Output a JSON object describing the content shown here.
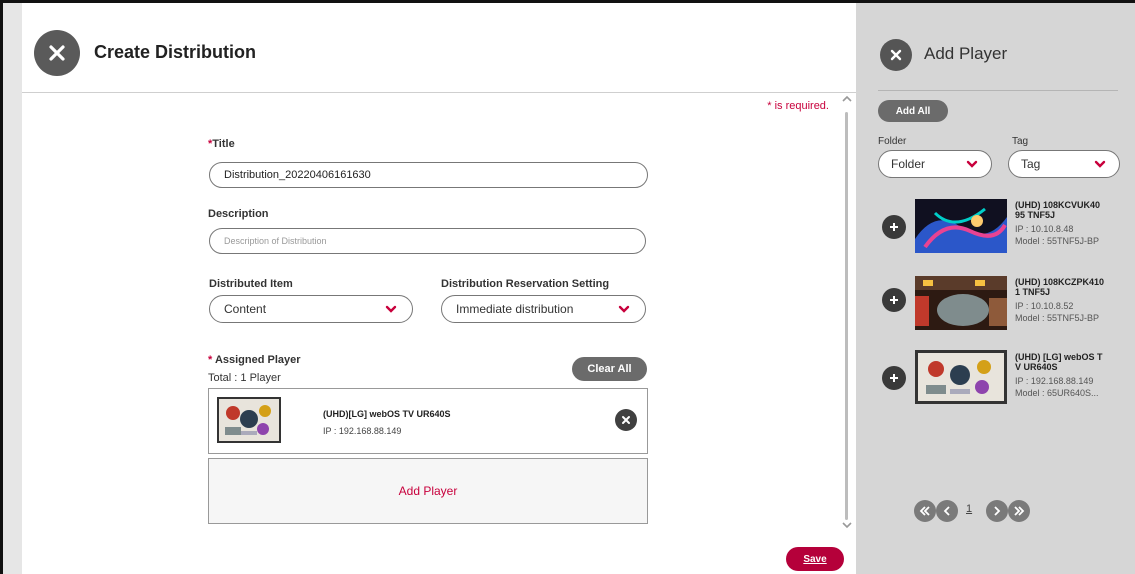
{
  "create_distribution": {
    "title": "Create Distribution",
    "required_note": "* is required.",
    "title_label_star": "*",
    "title_label": "Title",
    "title_value": "Distribution_20220406161630",
    "description_label": "Description",
    "description_placeholder": "Description of Distribution",
    "distributed_item_label": "Distributed Item",
    "distributed_item_value": "Content",
    "reservation_label": "Distribution Reservation Setting",
    "reservation_value": "Immediate distribution",
    "assigned_star": "*",
    "assigned_label": "Assigned Player",
    "total_text": "Total : 1 Player",
    "clear_all_label": "Clear All",
    "assigned_players": [
      {
        "name": "(UHD)[LG] webOS TV UR640S",
        "ip": "IP : 192.168.88.149"
      }
    ],
    "add_player_label": "Add Player",
    "save_label": "Save"
  },
  "add_player_panel": {
    "title": "Add Player",
    "add_all_label": "Add All",
    "folder_label": "Folder",
    "folder_value": "Folder",
    "tag_label": "Tag",
    "tag_value": "Tag",
    "players": [
      {
        "name_line1": "(UHD) 108KCVUK40",
        "name_line2": "95 TNF5J",
        "ip": "IP : 10.10.8.48",
        "model": "Model : 55TNF5J-BP"
      },
      {
        "name_line1": "(UHD) 108KCZPK410",
        "name_line2": "1 TNF5J",
        "ip": "IP : 10.10.8.52",
        "model": "Model : 55TNF5J-BP"
      },
      {
        "name_line1": "(UHD) [LG] webOS T",
        "name_line2": "V UR640S",
        "ip": "IP : 192.168.88.149",
        "model": "Model : 65UR640S..."
      }
    ],
    "page_number": "1"
  },
  "icons": {
    "close": "close-icon",
    "chevron": "chevron-down-icon",
    "plus": "plus-icon",
    "first": "first-page-icon",
    "prev": "prev-page-icon",
    "next": "next-page-icon",
    "last": "last-page-icon"
  },
  "colors": {
    "accent": "#c8003c",
    "save_button": "#b5003a",
    "panel_bg": "#d6d6d6",
    "dark_button": "#6b6b6b"
  }
}
